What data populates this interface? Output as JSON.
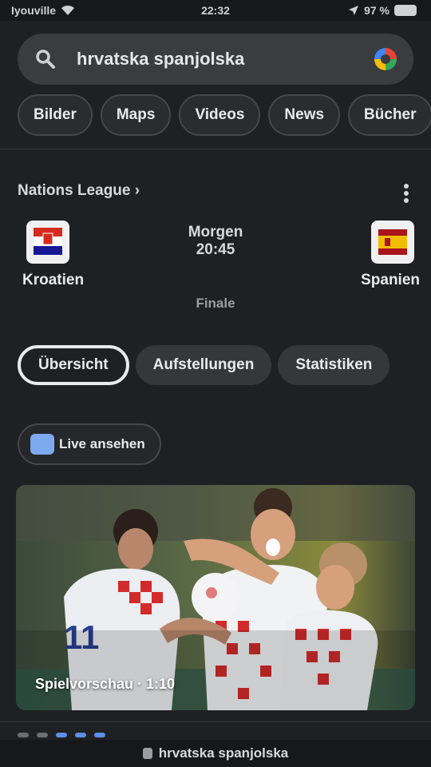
{
  "status_bar": {
    "carrier": "Iyouville",
    "time": "22:32",
    "battery": "97 %"
  },
  "search": {
    "query": "hrvatska spanjolska",
    "icon": "search-icon",
    "lens_icon": "google-lens-icon"
  },
  "filters": [
    "Bilder",
    "Maps",
    "Videos",
    "News",
    "Bücher"
  ],
  "match": {
    "league": "Nations League ›",
    "home": {
      "name": "Kroatien",
      "crest_colors": [
        "#d52b1e",
        "#ffffff",
        "#171796"
      ]
    },
    "away": {
      "name": "Spanien",
      "crest_colors": [
        "#aa151b",
        "#f1bf00"
      ]
    },
    "date": "Morgen",
    "time": "20:45",
    "stage": "Finale"
  },
  "tabs": [
    "Übersicht",
    "Aufstellungen",
    "Statistiken"
  ],
  "live_label": "Live ansehen",
  "highlight": {
    "caption": "Spielvorschau · 1:10"
  },
  "url_bar": "hrvatska spanjolska",
  "colors": {
    "background": "#1f2023",
    "surface": "#3a3c40",
    "accent": "#5d8ee8"
  }
}
